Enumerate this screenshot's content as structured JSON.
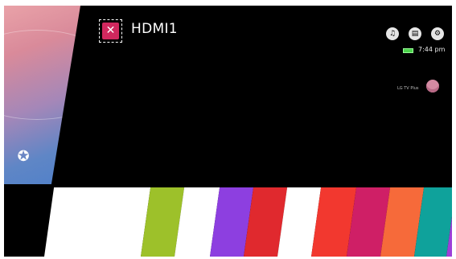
{
  "input": {
    "name": "HDMI1",
    "icon": "input-icon"
  },
  "top_buttons": [
    {
      "name": "music-button",
      "icon": "music-icon",
      "glyph": "♫"
    },
    {
      "name": "guide-button",
      "icon": "tv-guide-icon",
      "glyph": "▤"
    },
    {
      "name": "settings-button",
      "icon": "gear-icon",
      "glyph": "⚙"
    }
  ],
  "status": {
    "clock": "7:44 pm",
    "battery_color": "#4cd24c"
  },
  "user": {
    "name": "LG TV Plus"
  },
  "home_panel": {
    "favorite_icon": "star-icon",
    "favorite_glyph": "✪"
  },
  "app_tiles": [
    {
      "color": "#ffffff"
    },
    {
      "color": "#9dc12a"
    },
    {
      "color": "#ffffff"
    },
    {
      "color": "#8d3fe0"
    },
    {
      "color": "#e0292e"
    },
    {
      "color": "#ffffff"
    },
    {
      "color": "#f2382f"
    },
    {
      "color": "#cf1f66"
    },
    {
      "color": "#f66a3a"
    },
    {
      "color": "#0fa29b"
    },
    {
      "color": "#9e3fd8"
    }
  ]
}
